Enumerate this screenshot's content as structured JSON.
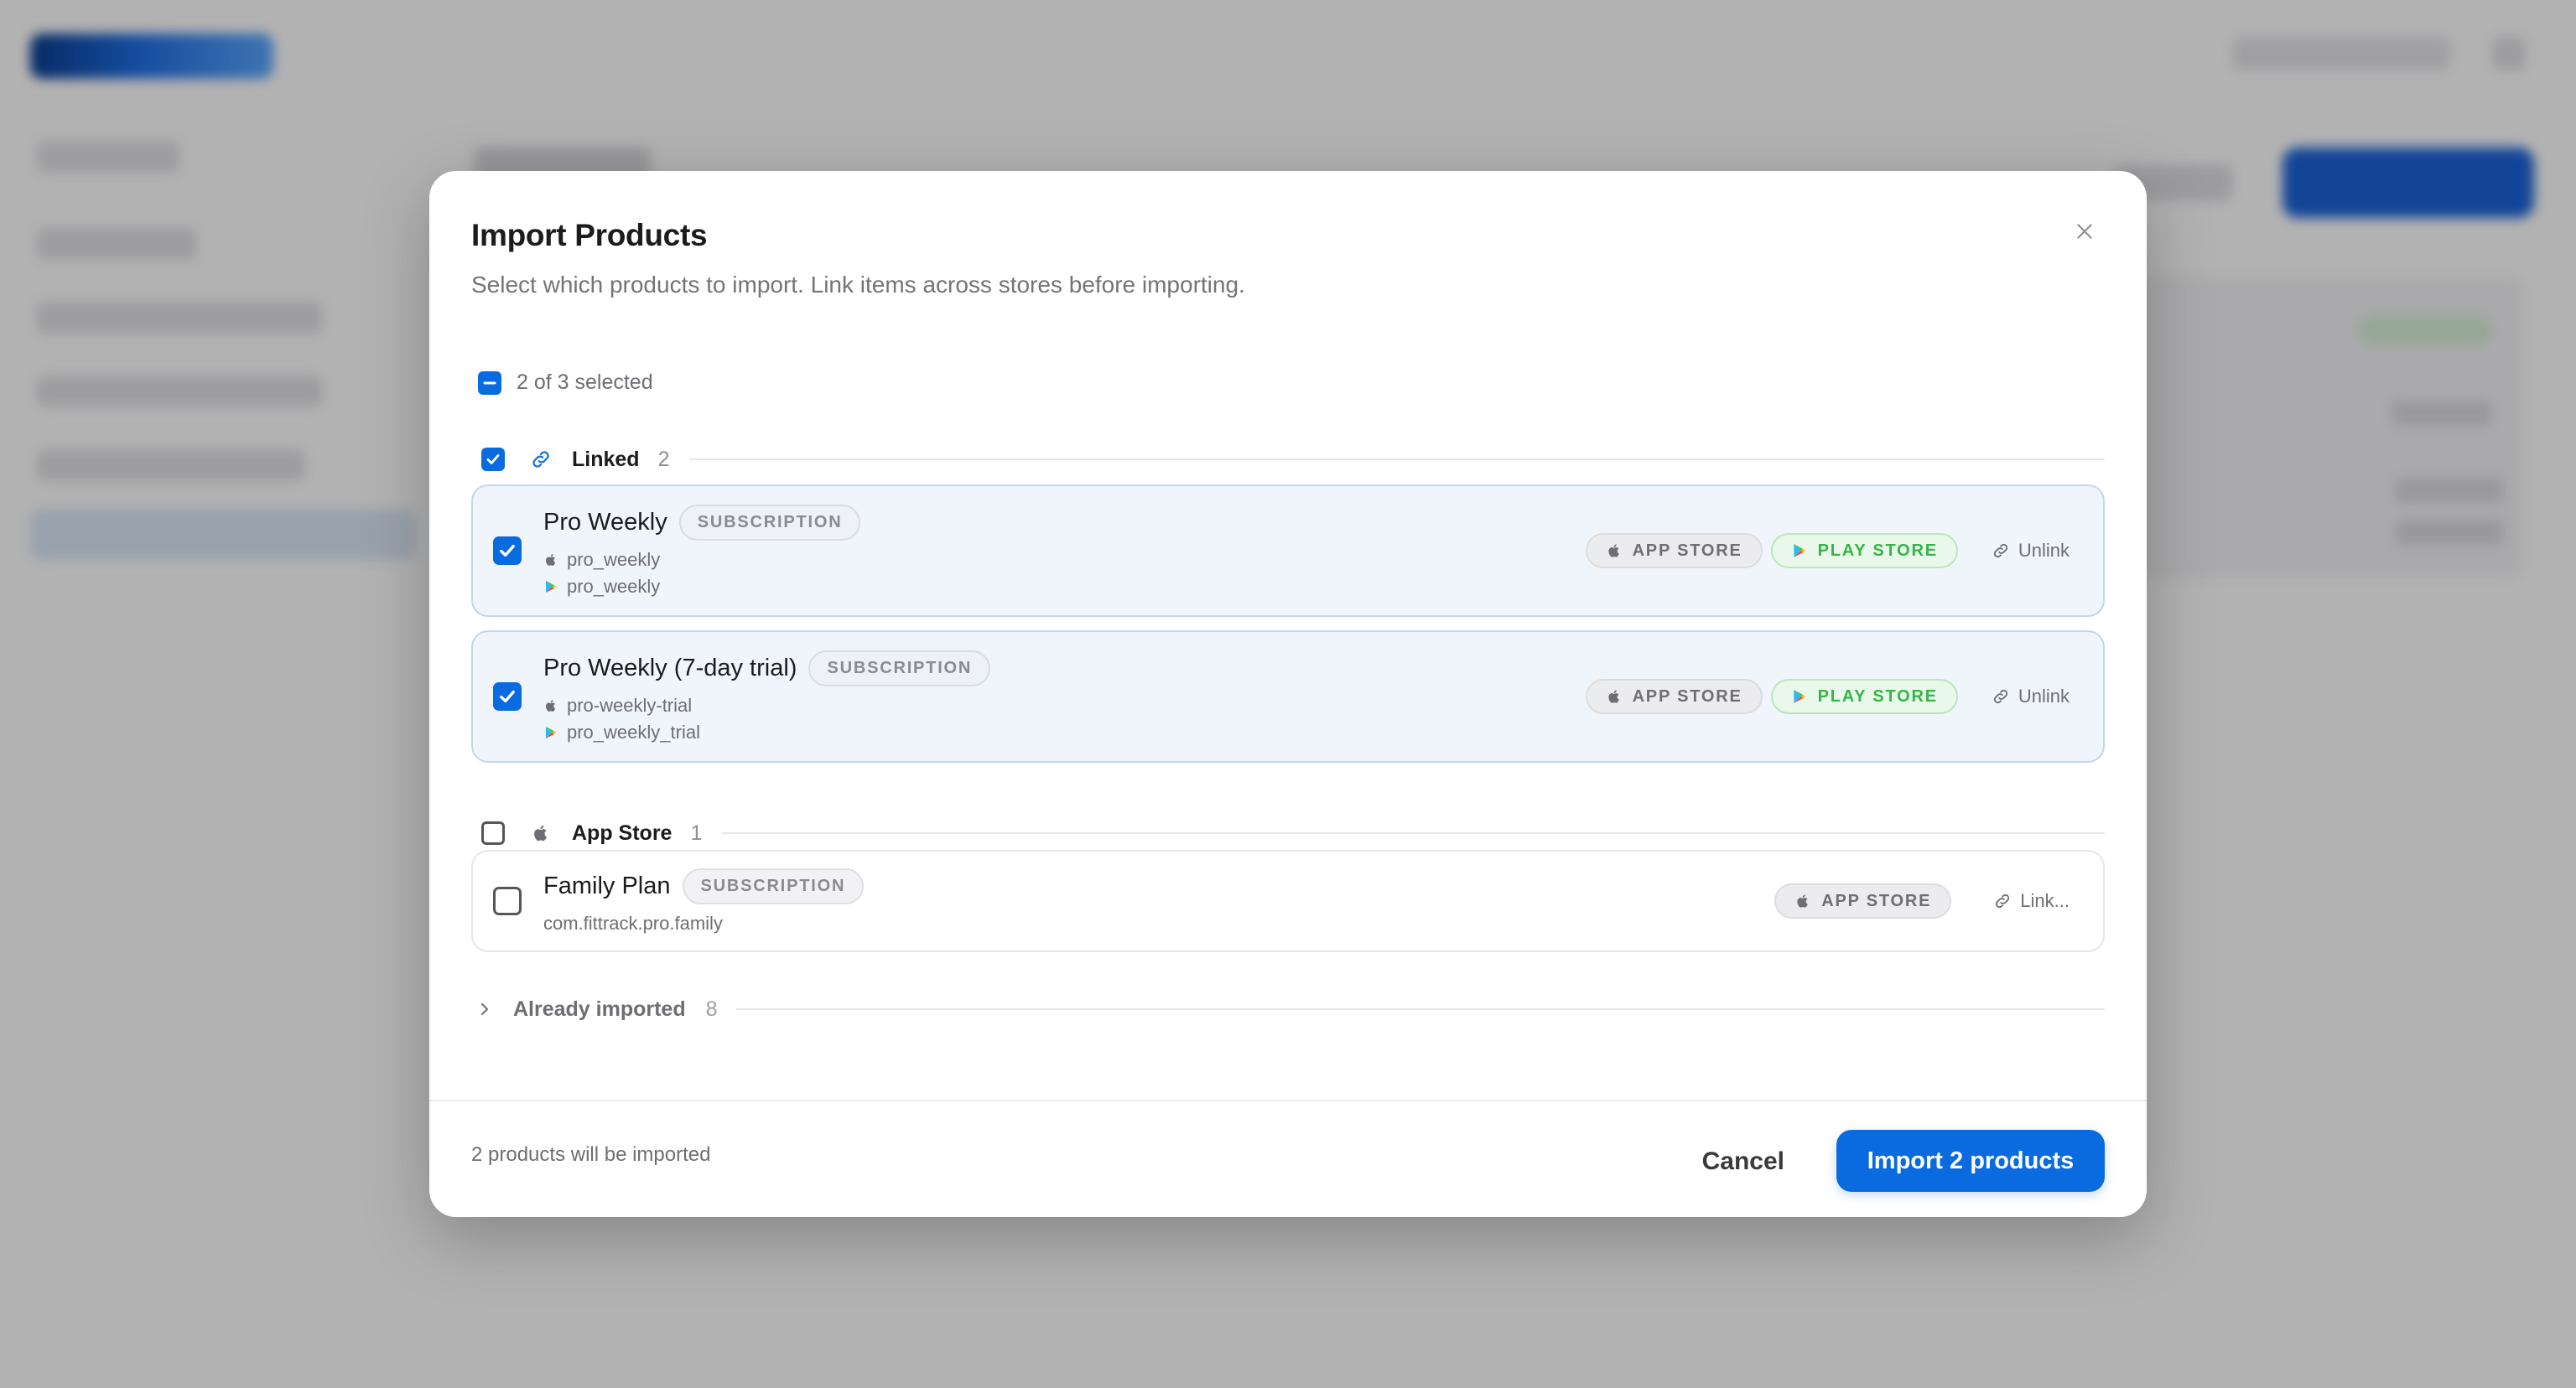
{
  "modal": {
    "title": "Import Products",
    "subtitle": "Select which products to import. Link items across stores before importing.",
    "selection_summary": "2 of 3 selected",
    "groups": {
      "linked": {
        "label": "Linked",
        "count": "2",
        "items": [
          {
            "name": "Pro Weekly",
            "badge": "SUBSCRIPTION",
            "app_store_id": "pro_weekly",
            "play_store_id": "pro_weekly",
            "app_store_label": "APP STORE",
            "play_store_label": "PLAY STORE",
            "action": "Unlink",
            "checked": true
          },
          {
            "name": "Pro Weekly (7-day trial)",
            "badge": "SUBSCRIPTION",
            "app_store_id": "pro-weekly-trial",
            "play_store_id": "pro_weekly_trial",
            "app_store_label": "APP STORE",
            "play_store_label": "PLAY STORE",
            "action": "Unlink",
            "checked": true
          }
        ]
      },
      "app_store": {
        "label": "App Store",
        "count": "1",
        "items": [
          {
            "name": "Family Plan",
            "badge": "SUBSCRIPTION",
            "bundle_id": "com.fittrack.pro.family",
            "app_store_label": "APP STORE",
            "action": "Link...",
            "checked": false
          }
        ]
      },
      "already_imported": {
        "label": "Already imported",
        "count": "8"
      }
    },
    "footer": {
      "note": "2 products will be imported",
      "cancel_label": "Cancel",
      "import_label": "Import 2 products"
    }
  },
  "colors": {
    "accent": "#0a6be0",
    "play_store_green": "#35b544",
    "linked_bg": "#f0f5fb"
  },
  "icons": {
    "close": "close-icon",
    "link": "link-icon",
    "apple": "apple-icon",
    "play": "play-store-icon",
    "chevron": "chevron-right-icon",
    "check": "check-icon",
    "minus": "minus-icon"
  }
}
